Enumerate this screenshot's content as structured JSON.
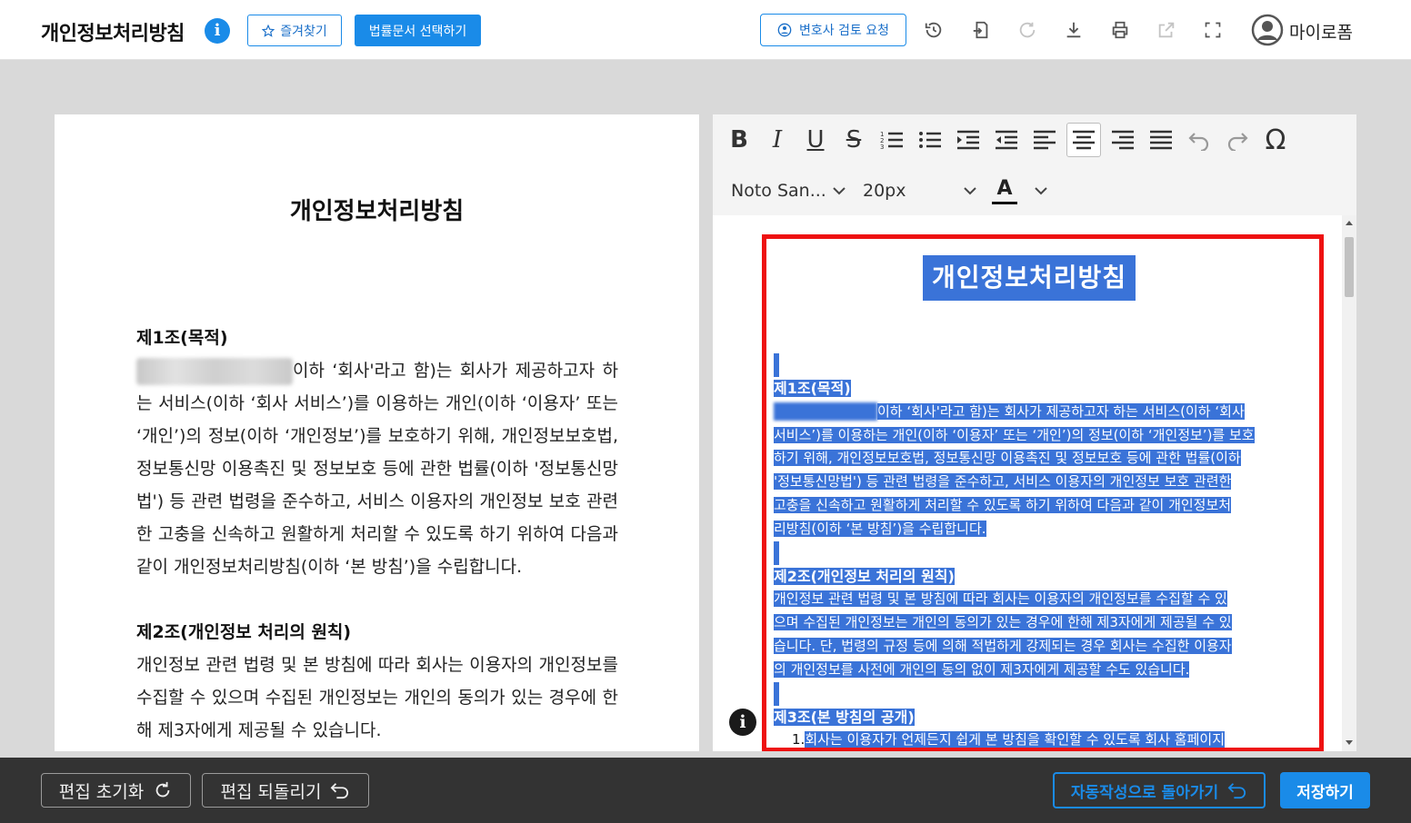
{
  "header": {
    "title": "개인정보처리방침",
    "favorite_label": "즐겨찾기",
    "select_legal_doc_label": "법률문서 선택하기",
    "lawyer_review_label": "변호사 검토 요청",
    "mypage_label": "마이로폼"
  },
  "preview": {
    "title": "개인정보처리방침",
    "art1_heading": "제1조(목적)",
    "art1_line1": "이하 ‘회사'라고 함)는 회사가 제공하고자",
    "art1_rest": "하는 서비스(이하 ‘회사 서비스’)를 이용하는 개인(이하 ‘이용자’ 또는 ‘개인’)의 정보(이하 ‘개인정보’)를 보호하기 위해, 개인정보보호법, 정보통신망 이용촉진 및 정보보호 등에 관한 법률(이하 '정보통신망법') 등 관련 법령을 준수하고, 서비스 이용자의 개인정보 보호 관련한 고충을 신속하고 원활하게 처리할 수 있도록 하기 위하여 다음과 같이 개인정보처리방침(이하 ‘본 방침’)을 수립합니다.",
    "art2_heading": "제2조(개인정보 처리의 원칙)",
    "art2_body": "개인정보 관련 법령 및 본 방침에 따라 회사는 이용자의 개인정보를 수집할 수 있으며 수집된 개인정보는 개인의 동의가 있는 경우에 한해 제3자에게 제공될 수 있습니다."
  },
  "toolbar": {
    "font_family": "Noto San...",
    "font_size": "20px",
    "color_letter": "A",
    "icons": [
      "bold-icon",
      "italic-icon",
      "underline-icon",
      "strikethrough-icon",
      "ordered-list-icon",
      "bullet-list-icon",
      "indent-icon",
      "outdent-icon",
      "align-left-icon",
      "align-center-icon",
      "align-right-icon",
      "align-justify-icon",
      "undo-icon",
      "redo-icon",
      "special-char-icon"
    ]
  },
  "editor": {
    "title": "개인정보처리방침",
    "art1_heading": "제1조(목적)",
    "art1_lines": [
      "이하 ‘회사'라고 함)는 회사가 제공하고자 하는 서비스(이하 ‘회사",
      "서비스’)를 이용하는 개인(이하 ‘이용자’ 또는 ‘개인’)의 정보(이하 ‘개인정보’)를 보호",
      "하기 위해, 개인정보보호법, 정보통신망 이용촉진 및 정보보호 등에 관한 법률(이하",
      "'정보통신망법') 등 관련 법령을 준수하고, 서비스 이용자의 개인정보 보호 관련한",
      "고충을 신속하고 원활하게 처리할 수 있도록 하기 위하여 다음과 같이 개인정보처",
      "리방침(이하 ‘본 방침’)을 수립합니다."
    ],
    "art2_heading": "제2조(개인정보 처리의 원칙)",
    "art2_lines": [
      "개인정보 관련 법령 및 본 방침에 따라 회사는 이용자의 개인정보를 수집할 수 있",
      "으며 수집된 개인정보는 개인의 동의가 있는 경우에 한해 제3자에게 제공될 수 있",
      "습니다. 단, 법령의 규정 등에 의해 적법하게 강제되는 경우 회사는 수집한 이용자",
      "의 개인정보를 사전에 개인의 동의 없이 제3자에게 제공할 수도 있습니다."
    ],
    "art3_heading": "제3조(본 방침의 공개)",
    "art3_item_num": "1.",
    "art3_item1": "회사는 이용자가 언제든지 쉽게 본 방침을 확인할 수 있도록 회사 홈페이지"
  },
  "footer": {
    "reset_label": "편집 초기화",
    "revert_label": "편집 되돌리기",
    "back_to_auto_label": "자동작성으로 돌아가기",
    "save_label": "저장하기"
  },
  "colors": {
    "accent": "#1a8be8",
    "selection": "#3a73d8",
    "highlight_border": "#ee1111",
    "footer_bg": "#333333"
  }
}
